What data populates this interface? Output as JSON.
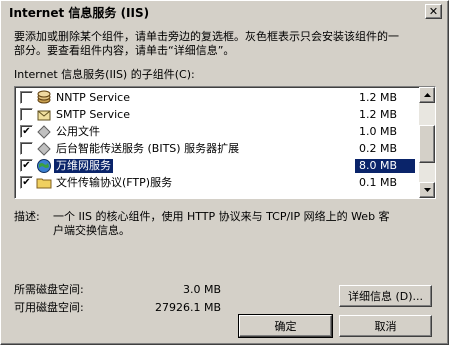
{
  "window": {
    "title": "Internet 信息服务 (IIS)",
    "close_glyph": "✕"
  },
  "instructions": {
    "line1": "要添加或删除某个组件，请单击旁边的复选框。灰色框表示只会安装该组件的一",
    "line2": "部分。要查看组件内容，请单击“详细信息”。"
  },
  "subcomponents_label": "Internet 信息服务(IIS) 的子组件(C):",
  "components": [
    {
      "name": "NNTP Service",
      "size": "1.2 MB",
      "checked": false,
      "icon": "news-service-icon"
    },
    {
      "name": "SMTP Service",
      "size": "1.2 MB",
      "checked": false,
      "icon": "mail-service-icon"
    },
    {
      "name": "公用文件",
      "size": "1.0 MB",
      "checked": true,
      "icon": "component-icon"
    },
    {
      "name": "后台智能传送服务 (BITS) 服务器扩展",
      "size": "0.2 MB",
      "checked": false,
      "icon": "component-icon"
    },
    {
      "name": "万维网服务",
      "size": "8.0 MB",
      "checked": true,
      "selected": true,
      "icon": "globe-icon"
    },
    {
      "name": "文件传输协议(FTP)服务",
      "size": "0.1 MB",
      "checked": true,
      "icon": "folder-icon"
    }
  ],
  "description": {
    "label": "描述:",
    "line1": "一个 IIS 的核心组件，使用 HTTP 协议来与 TCP/IP 网络上的 Web 客",
    "line2": "户端交换信息。"
  },
  "disk": {
    "required_label": "所需磁盘空间:",
    "required_value": "3.0 MB",
    "available_label": "可用磁盘空间:",
    "available_value": "27926.1 MB"
  },
  "buttons": {
    "details": "详细信息 (D)...",
    "ok": "确定",
    "cancel": "取消"
  }
}
